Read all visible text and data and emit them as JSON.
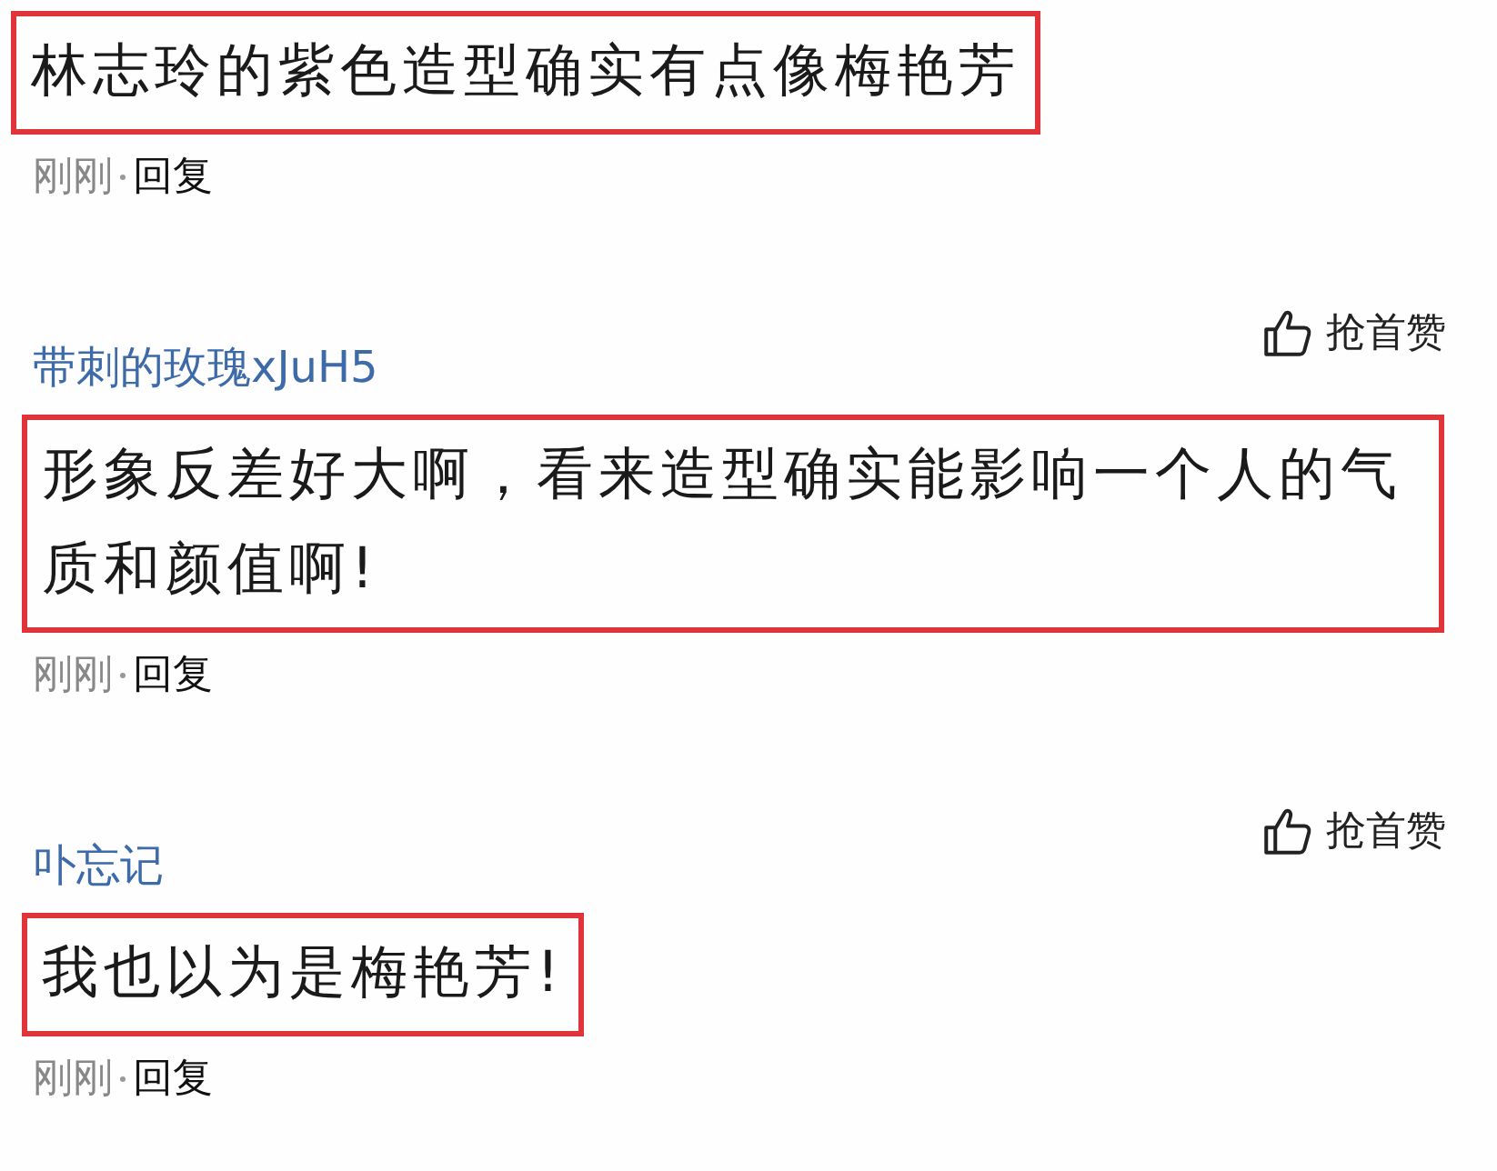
{
  "comments": [
    {
      "text": "林志玲的紫色造型确实有点像梅艳芳",
      "highlighted": true,
      "time": "刚刚",
      "reply": "回复"
    },
    {
      "author": "带刺的玫瑰xJuH5",
      "like": "抢首赞",
      "text": "形象反差好大啊，看来造型确实能影响一个人的气质和颜值啊!",
      "highlighted": true,
      "time": "刚刚",
      "reply": "回复"
    },
    {
      "author": "卟忘记",
      "like": "抢首赞",
      "text": "我也以为是梅艳芳!",
      "highlighted": true,
      "time": "刚刚",
      "reply": "回复"
    }
  ]
}
